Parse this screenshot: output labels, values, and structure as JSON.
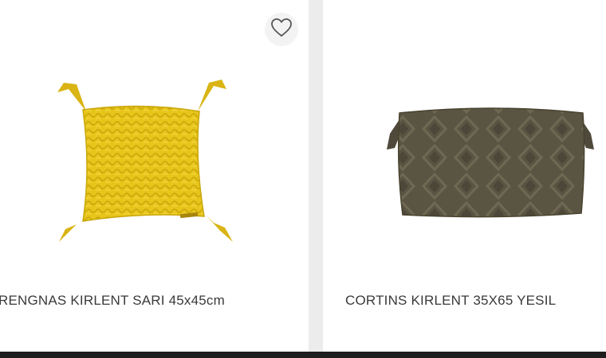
{
  "products": [
    {
      "name": "RENGNAS KIRLENT SARI 45x45cm",
      "image_icon": "yellow-knit-cushion",
      "favorite_icon": "heart-outline-icon",
      "color": "#e8c51a"
    },
    {
      "name": "CORTINS KIRLENT 35X65 YESIL",
      "image_icon": "olive-knit-cushion",
      "color": "#5a5443"
    }
  ],
  "colors": {
    "page_background": "#ececec",
    "card_background": "#ffffff",
    "text": "#3a3a3a",
    "bottom_bar": "#1e1e1e"
  }
}
